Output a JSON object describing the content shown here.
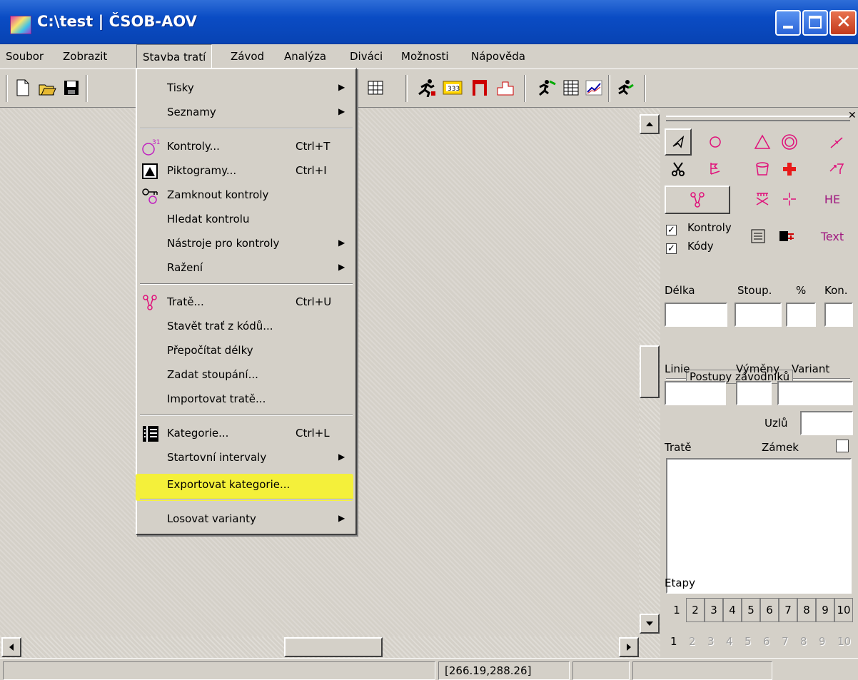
{
  "window": {
    "title": "C:\\test | ČSOB-AOV"
  },
  "menubar": {
    "items": [
      "Soubor",
      "Zobrazit",
      "Stavba tratí",
      "Závod",
      "Analýza",
      "Diváci",
      "Možnosti",
      "Nápověda"
    ]
  },
  "menu": {
    "items": [
      {
        "label": "Tisky",
        "shortcut": "",
        "submenu": true
      },
      {
        "label": "Seznamy",
        "shortcut": "",
        "submenu": true
      },
      {
        "label": "Kontroly...",
        "shortcut": "Ctrl+T",
        "submenu": false
      },
      {
        "label": "Piktogramy...",
        "shortcut": "Ctrl+I",
        "submenu": false
      },
      {
        "label": "Zamknout kontroly",
        "shortcut": "",
        "submenu": false
      },
      {
        "label": "Hledat kontrolu",
        "shortcut": "",
        "submenu": false
      },
      {
        "label": "Nástroje pro kontroly",
        "shortcut": "",
        "submenu": true
      },
      {
        "label": "Ražení",
        "shortcut": "",
        "submenu": true
      },
      {
        "label": "Tratě...",
        "shortcut": "Ctrl+U",
        "submenu": false
      },
      {
        "label": "Stavět trať z kódů...",
        "shortcut": "",
        "submenu": false
      },
      {
        "label": "Přepočítat délky",
        "shortcut": "",
        "submenu": false
      },
      {
        "label": "Zadat stoupání...",
        "shortcut": "",
        "submenu": false
      },
      {
        "label": "Importovat tratě...",
        "shortcut": "",
        "submenu": false
      },
      {
        "label": "Kategorie...",
        "shortcut": "Ctrl+L",
        "submenu": false
      },
      {
        "label": "Startovní intervaly",
        "shortcut": "",
        "submenu": true
      },
      {
        "label": "Exportovat kategorie...",
        "shortcut": "",
        "submenu": false
      },
      {
        "label": "Losovat varianty",
        "shortcut": "",
        "submenu": true
      }
    ],
    "highlight_color": "#f4f03a"
  },
  "panel": {
    "palette_labels": {
      "he": "HE",
      "text": "Text"
    },
    "check_kontroly": "Kontroly",
    "check_kody": "Kódy",
    "group_label": "Postupy závodníků",
    "delka": "Délka",
    "stoup": "Stoup.",
    "percent": "%",
    "kon": "Kon.",
    "linie": "Linie",
    "vymeny": "Výměny",
    "variant": "Variant",
    "uzlu": "Uzlů",
    "trate": "Tratě",
    "zamek": "Zámek",
    "etapy": "Etapy",
    "stages": [
      "1",
      "2",
      "3",
      "4",
      "5",
      "6",
      "7",
      "8",
      "9",
      "10"
    ]
  },
  "statusbar": {
    "coords": "[266.19,288.26]"
  }
}
